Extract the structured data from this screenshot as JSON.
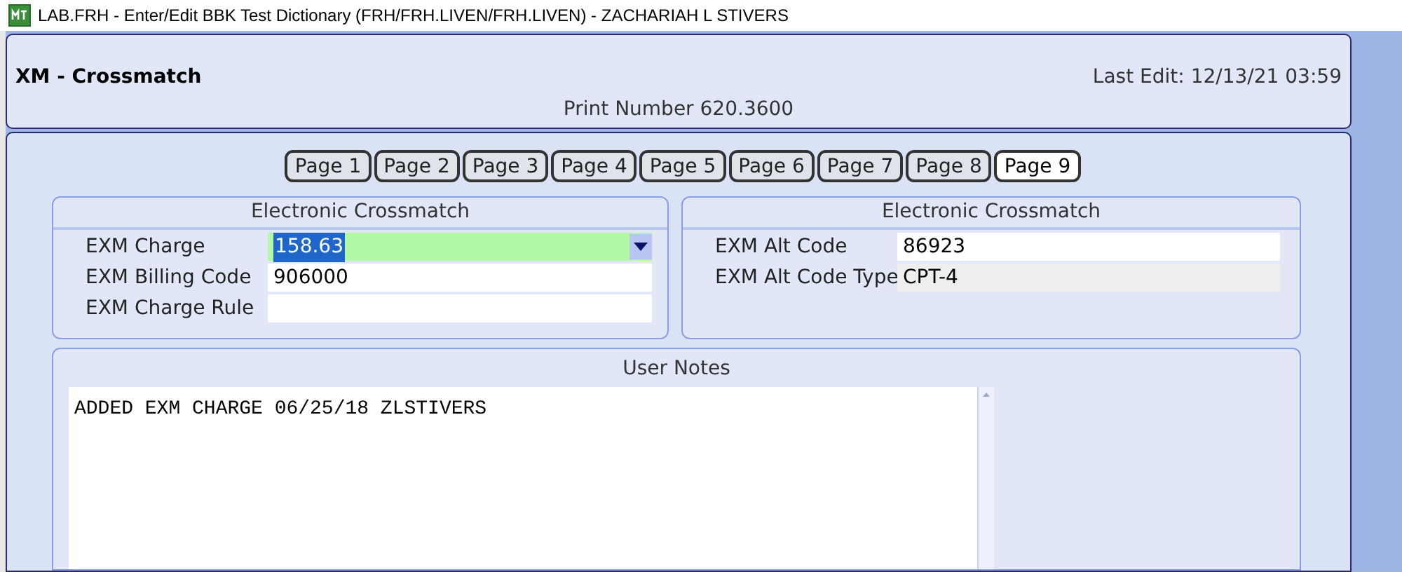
{
  "window": {
    "title": "LAB.FRH - Enter/Edit BBK Test Dictionary (FRH/FRH.LIVEN/FRH.LIVEN) - ZACHARIAH L STIVERS"
  },
  "header": {
    "title": "XM - Crossmatch",
    "last_edit": "Last Edit: 12/13/21 03:59",
    "print_number": "Print Number 620.3600"
  },
  "tabs": [
    {
      "label": "Page 1",
      "selected": false
    },
    {
      "label": "Page 2",
      "selected": false
    },
    {
      "label": "Page 3",
      "selected": false
    },
    {
      "label": "Page 4",
      "selected": false
    },
    {
      "label": "Page 5",
      "selected": false
    },
    {
      "label": "Page 6",
      "selected": false
    },
    {
      "label": "Page 7",
      "selected": false
    },
    {
      "label": "Page 8",
      "selected": false
    },
    {
      "label": "Page 9",
      "selected": true
    }
  ],
  "groups": [
    {
      "title": "Electronic Crossmatch",
      "fields": [
        {
          "label": "EXM Charge",
          "value": "158.63",
          "kind": "combo",
          "focused": true
        },
        {
          "label": "EXM Billing Code",
          "value": "906000",
          "kind": "text",
          "focused": false
        },
        {
          "label": "EXM Charge Rule",
          "kind": "text",
          "focused": false
        }
      ]
    },
    {
      "title": "Electronic Crossmatch",
      "fields": [
        {
          "label": "EXM Alt Code",
          "value": "86923",
          "kind": "text",
          "focused": false
        },
        {
          "label": "EXM Alt Code Type",
          "value": "CPT-4",
          "kind": "readonly",
          "focused": false
        }
      ]
    }
  ],
  "notes": {
    "title": "User Notes",
    "value": "ADDED EXM CHARGE 06/25/18 ZLSTIVERS"
  }
}
